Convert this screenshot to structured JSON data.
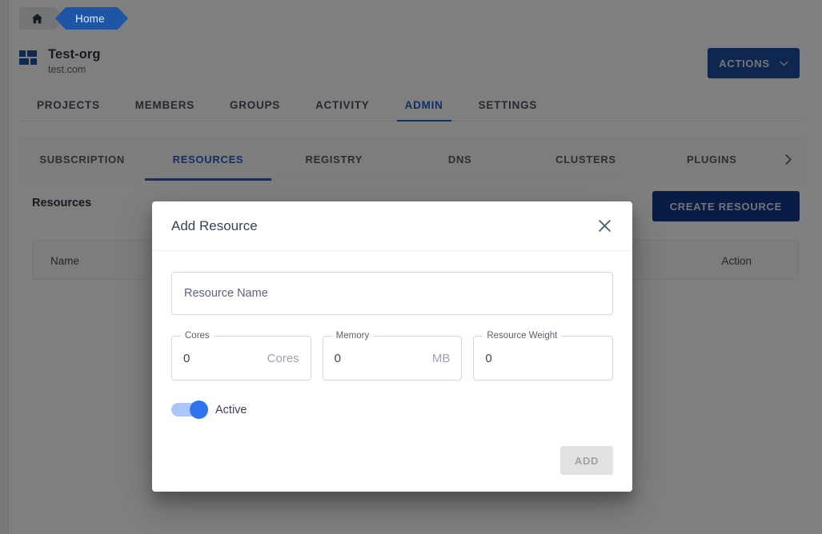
{
  "breadcrumb": {
    "home_icon": "home-icon",
    "items": [
      "Home"
    ]
  },
  "org": {
    "name": "Test-org",
    "domain": "test.com",
    "logo_icon": "grid-squares-icon"
  },
  "header": {
    "actions_label": "ACTIONS",
    "actions_caret_icon": "chevron-down-icon"
  },
  "primary_tabs": [
    {
      "label": "PROJECTS",
      "active": false
    },
    {
      "label": "MEMBERS",
      "active": false
    },
    {
      "label": "GROUPS",
      "active": false
    },
    {
      "label": "ACTIVITY",
      "active": false
    },
    {
      "label": "ADMIN",
      "active": true
    },
    {
      "label": "SETTINGS",
      "active": false
    }
  ],
  "sub_tabs": [
    {
      "label": "SUBSCRIPTION",
      "active": false
    },
    {
      "label": "RESOURCES",
      "active": true
    },
    {
      "label": "REGISTRY",
      "active": false
    },
    {
      "label": "DNS",
      "active": false
    },
    {
      "label": "CLUSTERS",
      "active": false
    },
    {
      "label": "PLUGINS",
      "active": false
    }
  ],
  "sub_tabs_scroll_icon": "chevron-right-icon",
  "resources": {
    "section_title": "Resources",
    "create_button": "CREATE RESOURCE",
    "columns": [
      "Name",
      "Action"
    ],
    "rows": []
  },
  "modal": {
    "title": "Add Resource",
    "close_icon": "close-icon",
    "name_field": {
      "value": "",
      "placeholder": "Resource Name"
    },
    "number_fields": [
      {
        "label": "Cores",
        "value": "0",
        "suffix": "Cores"
      },
      {
        "label": "Memory",
        "value": "0",
        "suffix": "MB"
      },
      {
        "label": "Resource Weight",
        "value": "0",
        "suffix": ""
      }
    ],
    "toggle": {
      "label": "Active",
      "on": true
    },
    "submit_label": "ADD",
    "submit_enabled": false
  },
  "colors": {
    "brand_blue": "#1f5fd0",
    "breadcrumb_blue": "#1f55a5",
    "actions_blue": "#1f4f9c",
    "create_blue": "#10388c",
    "switch_track": "#a9c6f7",
    "switch_knob": "#2f74ee",
    "disabled_gray": "#e2e2e2"
  }
}
